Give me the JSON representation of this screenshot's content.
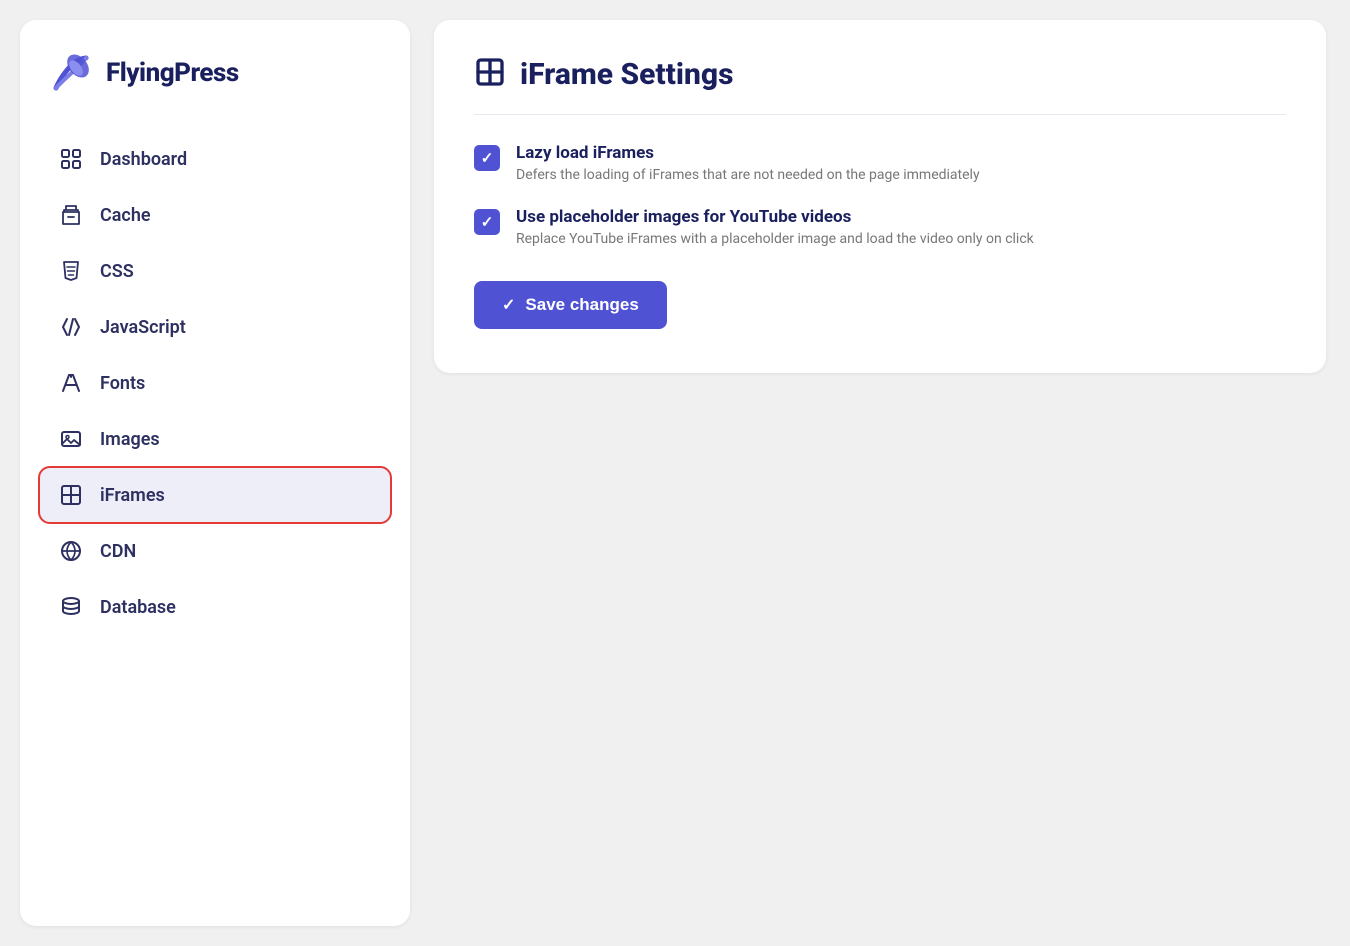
{
  "sidebar": {
    "logo": {
      "text": "FlyingPress"
    },
    "nav_items": [
      {
        "id": "dashboard",
        "label": "Dashboard",
        "icon": "dashboard-icon"
      },
      {
        "id": "cache",
        "label": "Cache",
        "icon": "cache-icon"
      },
      {
        "id": "css",
        "label": "CSS",
        "icon": "css-icon"
      },
      {
        "id": "javascript",
        "label": "JavaScript",
        "icon": "javascript-icon"
      },
      {
        "id": "fonts",
        "label": "Fonts",
        "icon": "fonts-icon"
      },
      {
        "id": "images",
        "label": "Images",
        "icon": "images-icon"
      },
      {
        "id": "iframes",
        "label": "iFrames",
        "icon": "iframes-icon",
        "active": true
      },
      {
        "id": "cdn",
        "label": "CDN",
        "icon": "cdn-icon"
      },
      {
        "id": "database",
        "label": "Database",
        "icon": "database-icon"
      }
    ]
  },
  "main": {
    "page_title": "iFrame Settings",
    "settings": [
      {
        "id": "lazy-load-iframes",
        "label": "Lazy load iFrames",
        "description": "Defers the loading of iFrames that are not needed on the page immediately",
        "checked": true
      },
      {
        "id": "placeholder-images",
        "label": "Use placeholder images for YouTube videos",
        "description": "Replace YouTube iFrames with a placeholder image and load the video only on click",
        "checked": true
      }
    ],
    "save_button_label": "Save changes"
  }
}
